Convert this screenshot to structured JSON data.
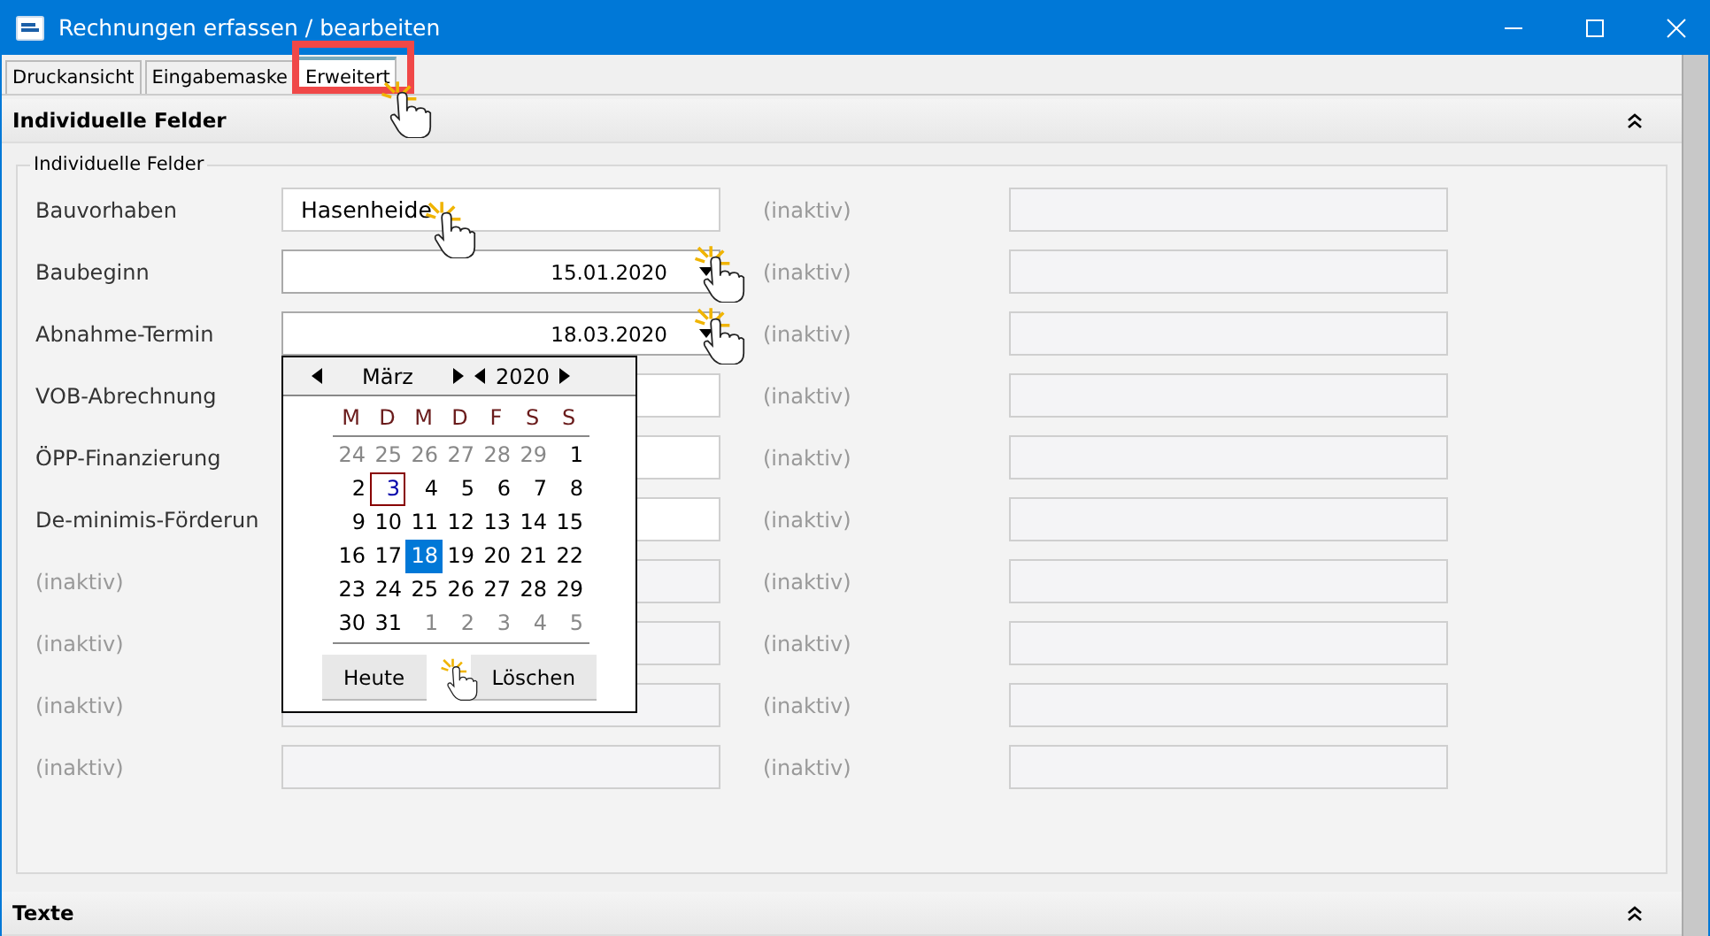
{
  "window": {
    "title": "Rechnungen erfassen / bearbeiten"
  },
  "tabs": [
    {
      "label": "Druckansicht",
      "selected": false
    },
    {
      "label": "Eingabemaske",
      "selected": false
    },
    {
      "label": "Erweitert",
      "selected": true,
      "highlighted": true
    }
  ],
  "section": {
    "title": "Individuelle Felder",
    "expanded": true
  },
  "group": {
    "title": "Individuelle Felder"
  },
  "rows": [
    {
      "label": "Bauvorhaben",
      "disabled": false,
      "field": {
        "kind": "text",
        "value": "Hasenheide"
      },
      "note": "(inaktiv)"
    },
    {
      "label": "Baubeginn",
      "disabled": false,
      "field": {
        "kind": "date",
        "value": "15.01.2020"
      },
      "note": "(inaktiv)"
    },
    {
      "label": "Abnahme-Termin",
      "disabled": false,
      "field": {
        "kind": "date",
        "value": "18.03.2020",
        "open": true
      },
      "note": "(inaktiv)"
    },
    {
      "label": "VOB-Abrechnung",
      "disabled": false,
      "field": {
        "kind": "text"
      },
      "note": "(inaktiv)"
    },
    {
      "label": "ÖPP-Finanzierung",
      "disabled": false,
      "field": {
        "kind": "text"
      },
      "note": "(inaktiv)"
    },
    {
      "label": "De-minimis-Förderun",
      "disabled": false,
      "field": {
        "kind": "text"
      },
      "note": "(inaktiv)"
    },
    {
      "label": "(inaktiv)",
      "disabled": true,
      "field": {
        "kind": "text"
      },
      "note": "(inaktiv)"
    },
    {
      "label": "(inaktiv)",
      "disabled": true,
      "field": {
        "kind": "text"
      },
      "note": "(inaktiv)"
    },
    {
      "label": "(inaktiv)",
      "disabled": true,
      "field": {
        "kind": "text"
      },
      "note": "(inaktiv)"
    },
    {
      "label": "(inaktiv)",
      "disabled": true,
      "field": {
        "kind": "text"
      },
      "note": "(inaktiv)"
    }
  ],
  "calendar": {
    "month": "März",
    "year": "2020",
    "weekdays": [
      "M",
      "D",
      "M",
      "D",
      "F",
      "S",
      "S"
    ],
    "weeks": [
      [
        {
          "day": "24",
          "other_month": true,
          "today": false,
          "selected": false
        },
        {
          "day": "25",
          "other_month": true,
          "today": false,
          "selected": false
        },
        {
          "day": "26",
          "other_month": true,
          "today": false,
          "selected": false
        },
        {
          "day": "27",
          "other_month": true,
          "today": false,
          "selected": false
        },
        {
          "day": "28",
          "other_month": true,
          "today": false,
          "selected": false
        },
        {
          "day": "29",
          "other_month": true,
          "today": false,
          "selected": false
        },
        {
          "day": "1",
          "other_month": false,
          "today": false,
          "selected": false
        }
      ],
      [
        {
          "day": "2",
          "other_month": false,
          "today": false,
          "selected": false
        },
        {
          "day": "3",
          "other_month": false,
          "today": true,
          "selected": false
        },
        {
          "day": "4",
          "other_month": false,
          "today": false,
          "selected": false
        },
        {
          "day": "5",
          "other_month": false,
          "today": false,
          "selected": false
        },
        {
          "day": "6",
          "other_month": false,
          "today": false,
          "selected": false
        },
        {
          "day": "7",
          "other_month": false,
          "today": false,
          "selected": false
        },
        {
          "day": "8",
          "other_month": false,
          "today": false,
          "selected": false
        }
      ],
      [
        {
          "day": "9",
          "other_month": false,
          "today": false,
          "selected": false
        },
        {
          "day": "10",
          "other_month": false,
          "today": false,
          "selected": false
        },
        {
          "day": "11",
          "other_month": false,
          "today": false,
          "selected": false
        },
        {
          "day": "12",
          "other_month": false,
          "today": false,
          "selected": false
        },
        {
          "day": "13",
          "other_month": false,
          "today": false,
          "selected": false
        },
        {
          "day": "14",
          "other_month": false,
          "today": false,
          "selected": false
        },
        {
          "day": "15",
          "other_month": false,
          "today": false,
          "selected": false
        }
      ],
      [
        {
          "day": "16",
          "other_month": false,
          "today": false,
          "selected": false
        },
        {
          "day": "17",
          "other_month": false,
          "today": false,
          "selected": false
        },
        {
          "day": "18",
          "other_month": false,
          "today": false,
          "selected": true
        },
        {
          "day": "19",
          "other_month": false,
          "today": false,
          "selected": false
        },
        {
          "day": "20",
          "other_month": false,
          "today": false,
          "selected": false
        },
        {
          "day": "21",
          "other_month": false,
          "today": false,
          "selected": false
        },
        {
          "day": "22",
          "other_month": false,
          "today": false,
          "selected": false
        }
      ],
      [
        {
          "day": "23",
          "other_month": false,
          "today": false,
          "selected": false
        },
        {
          "day": "24",
          "other_month": false,
          "today": false,
          "selected": false
        },
        {
          "day": "25",
          "other_month": false,
          "today": false,
          "selected": false
        },
        {
          "day": "26",
          "other_month": false,
          "today": false,
          "selected": false
        },
        {
          "day": "27",
          "other_month": false,
          "today": false,
          "selected": false
        },
        {
          "day": "28",
          "other_month": false,
          "today": false,
          "selected": false
        },
        {
          "day": "29",
          "other_month": false,
          "today": false,
          "selected": false
        }
      ],
      [
        {
          "day": "30",
          "other_month": false,
          "today": false,
          "selected": false
        },
        {
          "day": "31",
          "other_month": false,
          "today": false,
          "selected": false
        },
        {
          "day": "1",
          "other_month": true,
          "today": false,
          "selected": false
        },
        {
          "day": "2",
          "other_month": true,
          "today": false,
          "selected": false
        },
        {
          "day": "3",
          "other_month": true,
          "today": false,
          "selected": false
        },
        {
          "day": "4",
          "other_month": true,
          "today": false,
          "selected": false
        },
        {
          "day": "5",
          "other_month": true,
          "today": false,
          "selected": false
        }
      ]
    ],
    "buttons": [
      "Heute",
      "Löschen"
    ]
  },
  "bottom_section": {
    "title": "Texte",
    "expanded": true
  }
}
